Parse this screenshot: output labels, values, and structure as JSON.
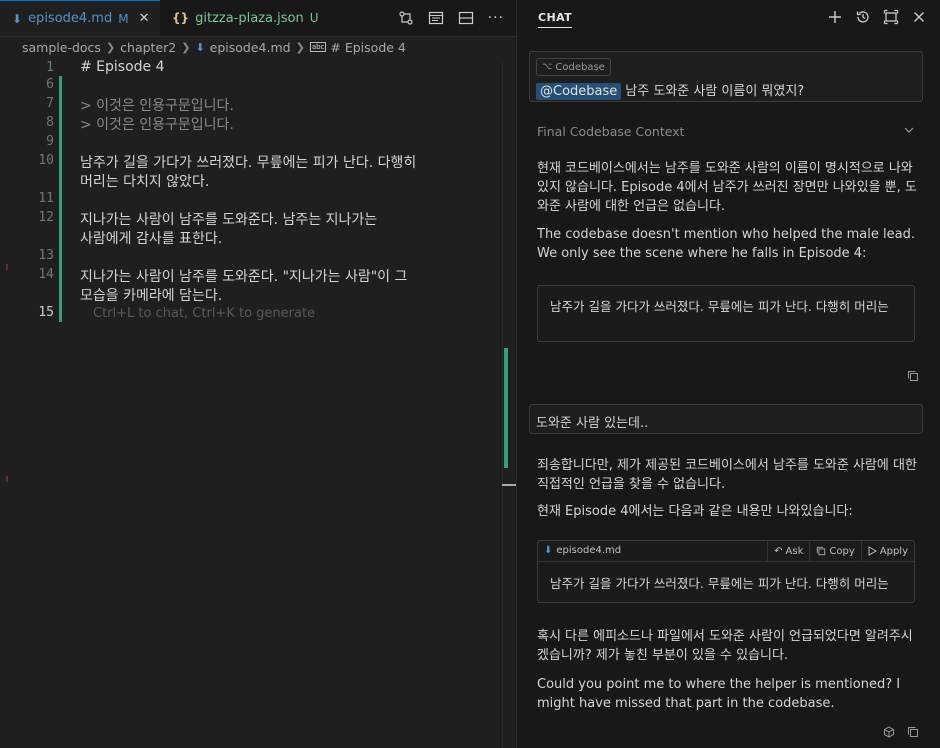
{
  "editor": {
    "tabs": [
      {
        "label": "episode4.md",
        "badge": "M",
        "active": true
      },
      {
        "label": "gitzza-plaza.json",
        "badge": "U",
        "active": false
      }
    ],
    "breadcrumb": [
      "sample-docs",
      "chapter2",
      "episode4.md",
      "# Episode 4"
    ],
    "lines": [
      {
        "num": "1",
        "text": "# Episode 4"
      },
      {
        "num": "6",
        "text": ""
      },
      {
        "num": "7",
        "text": "> 이것은 인용구문입니다."
      },
      {
        "num": "8",
        "text": "> 이것은 인용구문입니다."
      },
      {
        "num": "9",
        "text": ""
      },
      {
        "num": "10",
        "text": "남주가 길을 가다가 쓰러졌다. 무릎에는 피가 난다. 다행히",
        "wrap": "머리는 다치지 않았다."
      },
      {
        "num": "11",
        "text": ""
      },
      {
        "num": "12",
        "text": "지나가는 사람이 남주를 도와준다. 남주는 지나가는",
        "wrap": "사람에게 감사를 표한다."
      },
      {
        "num": "13",
        "text": ""
      },
      {
        "num": "14",
        "text": "지나가는 사람이 남주를 도와준다. \"지나가는 사람\"이 그",
        "wrap": "모습을 카메라에 담는다."
      },
      {
        "num": "15",
        "text": ""
      }
    ],
    "hint": "Ctrl+L to chat, Ctrl+K to generate"
  },
  "chat": {
    "title": "CHAT",
    "query": {
      "chip": "Codebase",
      "mention": "@Codebase",
      "text": "남주 도와준 사람 이름이 뭐였지?"
    },
    "final_context_label": "Final Codebase Context",
    "answer1": {
      "ko": "현재 코드베이스에서는 남주를 도와준 사람의 이름이 명시적으로 나와있지 않습니다. Episode 4에서 남주가 쓰러진 장면만 나와있을 뿐, 도와준 사람에 대한 언급은 없습니다.",
      "en": "The codebase doesn't mention who helped the male lead. We only see the scene where he falls in Episode 4:",
      "quote": "남주가 길을 가다가 쓰러졌다. 무릎에는 피가 난다. 다행히 머리는"
    },
    "user_message": "도와준 사람 있는데..",
    "answer2": {
      "ko": "죄송합니다만, 제가 제공된 코드베이스에서 남주를 도와준 사람에 대한 직접적인 언급을 찾을 수 없습니다.",
      "intro": "현재 Episode 4에서는 다음과 같은 내용만 나와있습니다:",
      "code_file": "episode4.md",
      "actions": {
        "ask": "Ask",
        "copy": "Copy",
        "apply": "Apply"
      },
      "quote": "남주가 길을 가다가 쓰러졌다. 무릎에는 피가 난다. 다행히 머리는",
      "ko2": "혹시 다른 에피소드나 파일에서 도와준 사람이 언급되었다면 알려주시겠습니까? 제가 놓친 부분이 있을 수 있습니다.",
      "en": "Could you point me to where the helper is mentioned? I might have missed that part in the codebase."
    }
  },
  "colors": {
    "accent": "#0078d4",
    "modified_gutter": "#2ea27f",
    "untracked_tab": "#73c991",
    "modified_tab": "#e2c08d",
    "mention_bg": "#264f78"
  }
}
